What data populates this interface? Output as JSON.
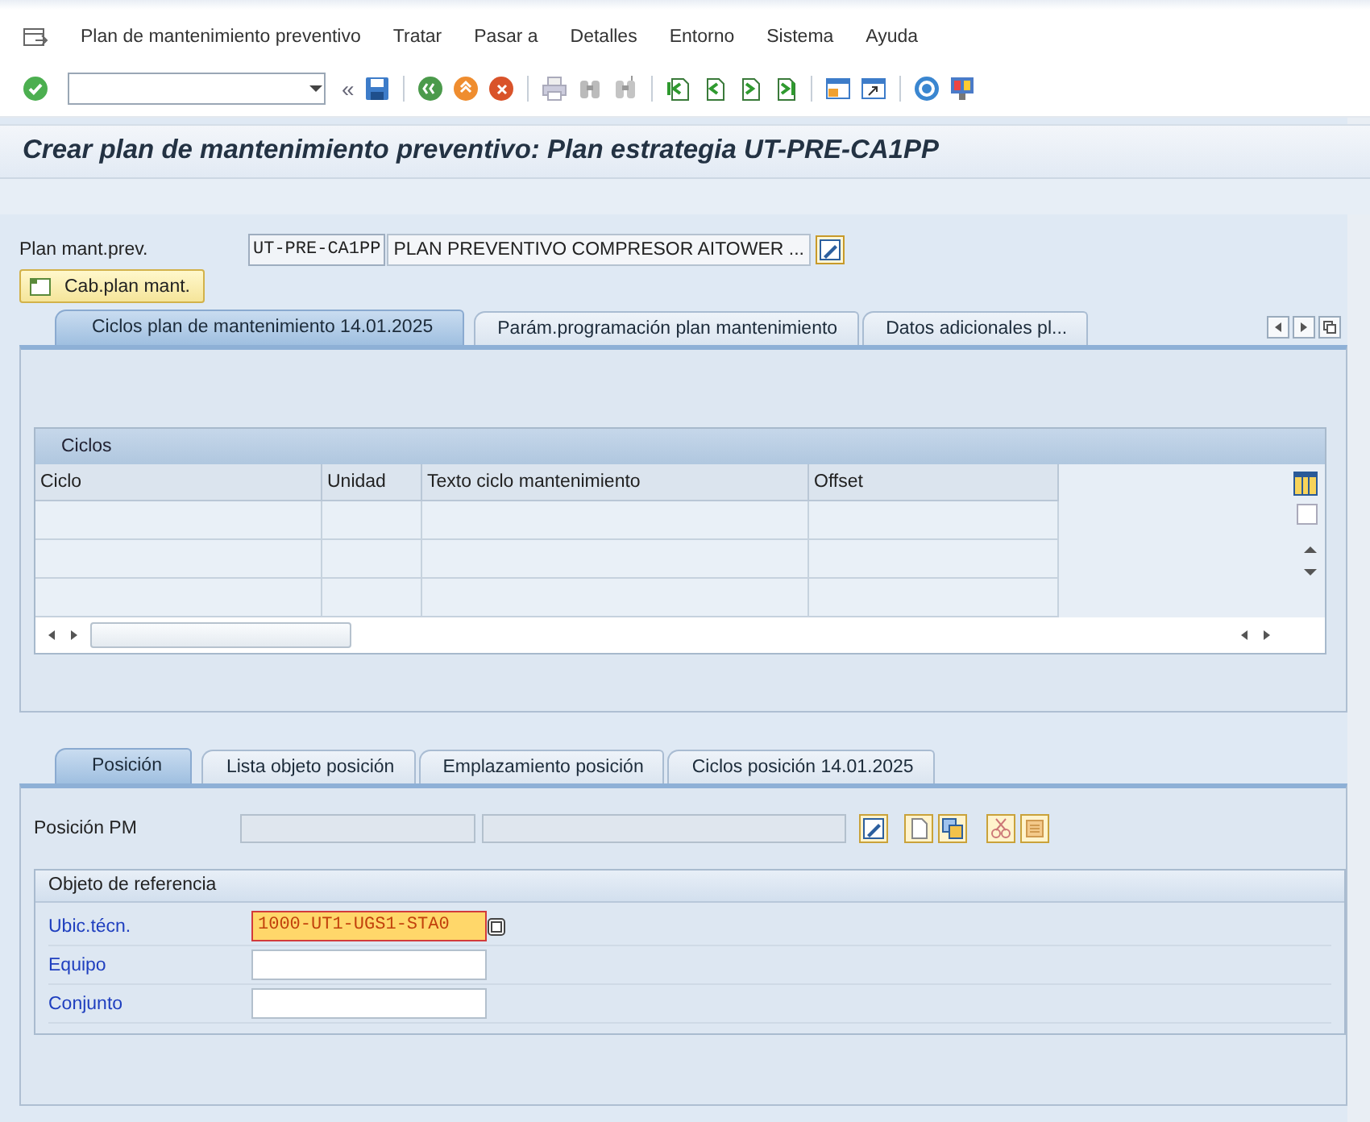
{
  "menu": [
    {
      "label": "Plan de mantenimiento preventivo"
    },
    {
      "label": "Tratar"
    },
    {
      "label": "Pasar a"
    },
    {
      "label": "Detalles"
    },
    {
      "label": "Entorno"
    },
    {
      "label": "Sistema"
    },
    {
      "label": "Ayuda"
    }
  ],
  "toolbar": {
    "collapse": "«"
  },
  "title": "Crear plan de mantenimiento preventivo: Plan estrategia UT-PRE-CA1PP",
  "plan": {
    "label": "Plan mant.prev.",
    "value": "UT-PRE-CA1PP",
    "description": "PLAN PREVENTIVO COMPRESOR AITOWER ...",
    "header_button": "Cab.plan mant."
  },
  "tabs": [
    {
      "label": "Ciclos plan de mantenimiento 14.01.2025",
      "selected": true
    },
    {
      "label": "Parám.programación plan mantenimiento",
      "selected": false
    },
    {
      "label": "Datos adicionales pl...",
      "selected": false
    }
  ],
  "cycles_table": {
    "title": "Ciclos",
    "columns": [
      "Ciclo",
      "Unidad",
      "Texto ciclo mantenimiento",
      "Offset"
    ]
  },
  "item_tabs": [
    {
      "label": "Posición",
      "selected": true
    },
    {
      "label": "Lista objeto posición",
      "selected": false
    },
    {
      "label": "Emplazamiento posición",
      "selected": false
    },
    {
      "label": "Ciclos posición 14.01.2025",
      "selected": false
    }
  ],
  "position": {
    "label": "Posición PM",
    "fields": [
      {
        "disabled": true
      },
      {
        "disabled": true
      }
    ]
  },
  "reference": {
    "title": "Objeto de referencia",
    "fields": [
      {
        "label": "Ubic.técn.",
        "value": "1000-UT1-UGS1-STA0",
        "highlighted": true
      },
      {
        "label": "Equipo",
        "highlighted": false
      },
      {
        "label": "Conjunto",
        "highlighted": false
      }
    ]
  }
}
